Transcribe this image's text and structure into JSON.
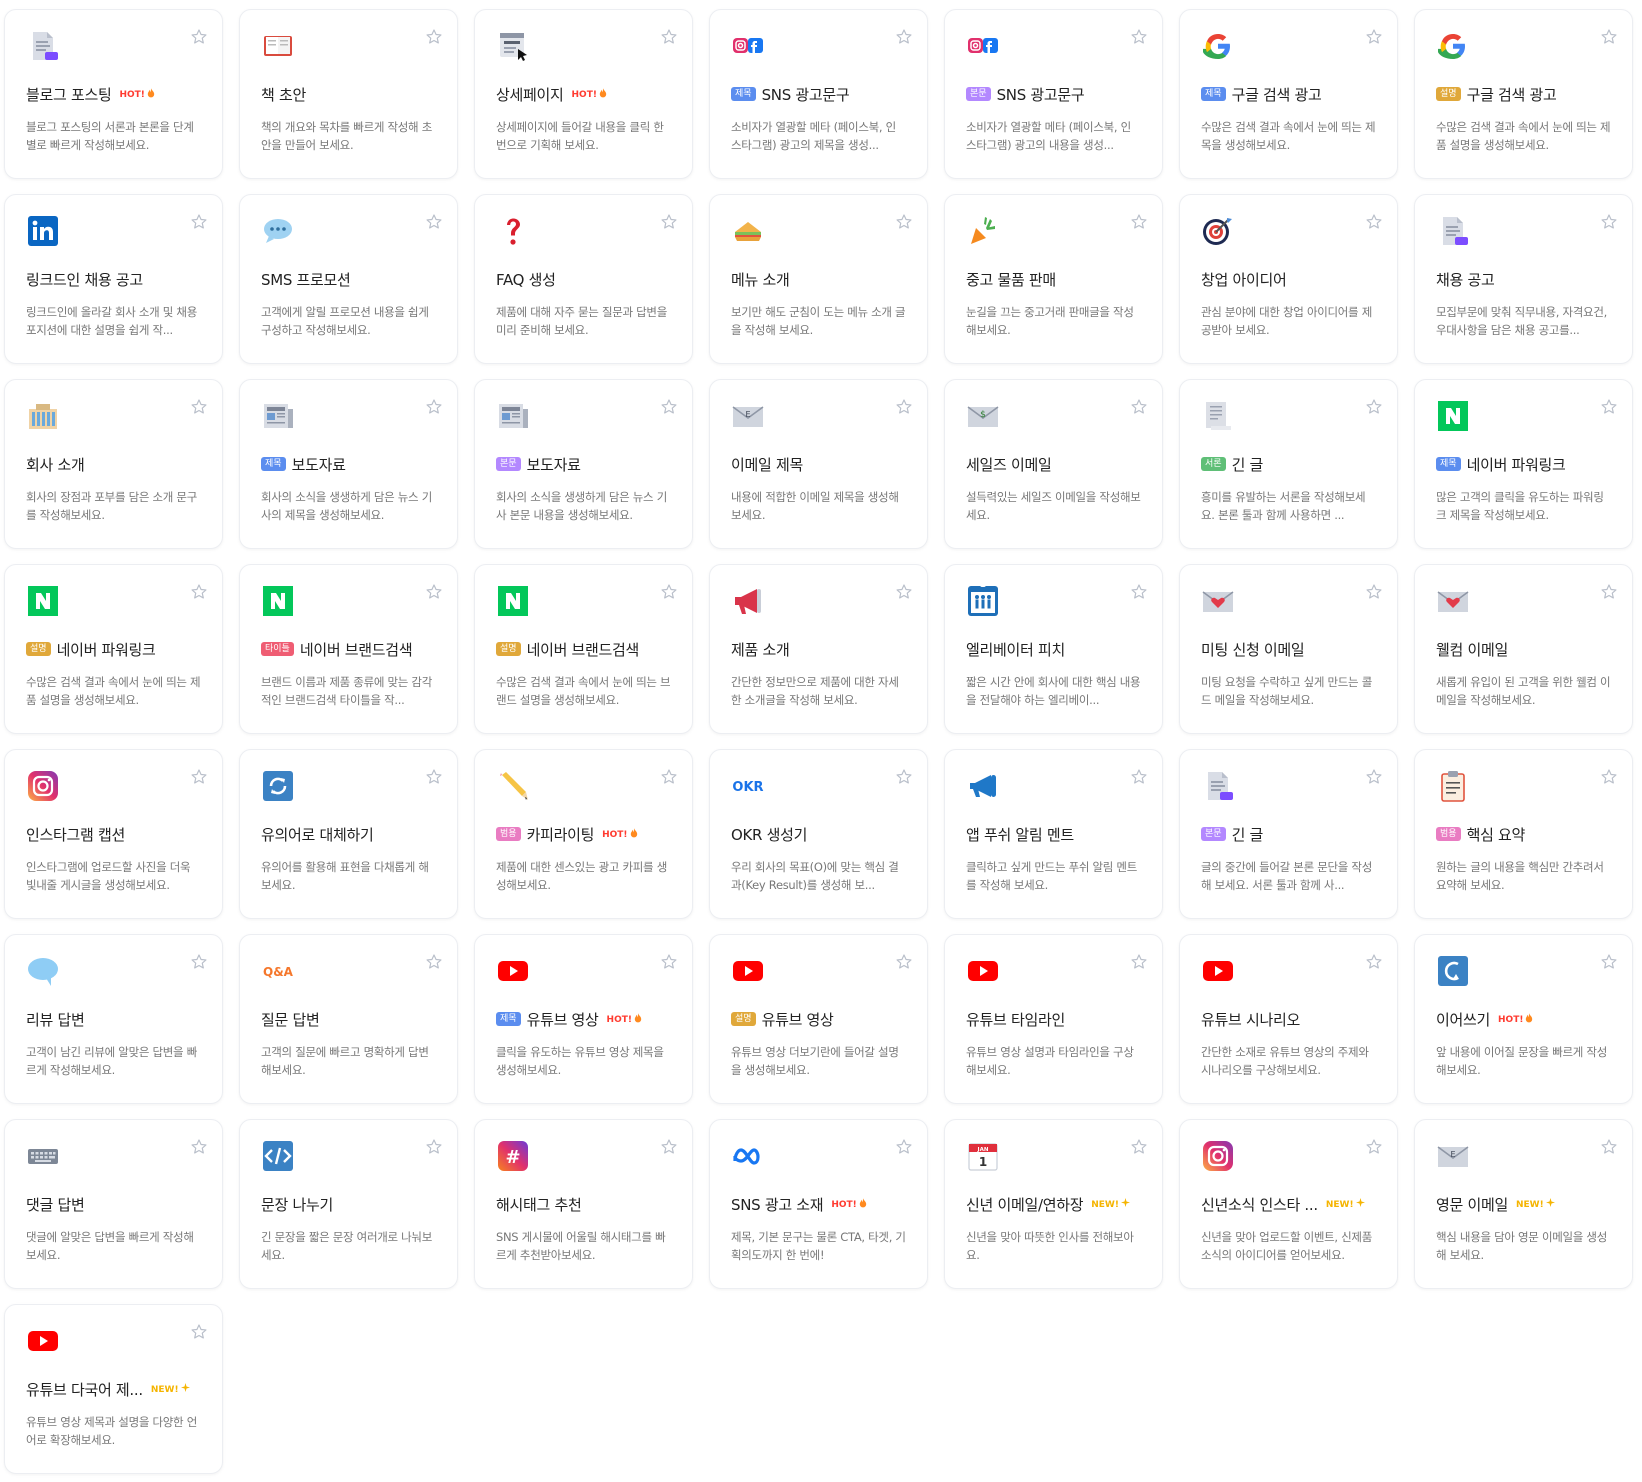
{
  "colors": {
    "tag_title": "#5b8def",
    "tag_body": "#b388ff",
    "tag_desc": "#e0a83a",
    "tag_intro": "#5fbf77",
    "tag_titles": "#ef5d73",
    "tag_general": "#e97cc2",
    "hot": "#ff3b30",
    "new": "#f5b400"
  },
  "cards": [
    {
      "title": "블로그 포스팅",
      "badge": "HOT!",
      "badge_icon": "fire-icon",
      "icon": "document-icon",
      "desc": "블로그 포스팅의 서론과 본론을 단계별로 빠르게 작성해보세요."
    },
    {
      "title": "책 초안",
      "icon": "book-icon",
      "desc": "책의 개요와 목차를 빠르게 작성해 초안을 만들어 보세요."
    },
    {
      "title": "상세페이지",
      "badge": "HOT!",
      "badge_icon": "fire-icon",
      "icon": "webpage-icon",
      "desc": "상세페이지에 들어갈 내용을 클릭 한 번으로 기획해 보세요."
    },
    {
      "tag": "제목",
      "tag_color": "#5b8def",
      "title": "SNS 광고문구",
      "icon": "instagram-facebook-icon",
      "desc": "소비자가 열광할 메타 (페이스북, 인스타그램) 광고의 제목을 생성..."
    },
    {
      "tag": "본문",
      "tag_color": "#b388ff",
      "title": "SNS 광고문구",
      "icon": "instagram-facebook-icon",
      "desc": "소비자가 열광할 메타 (페이스북, 인스타그램) 광고의 내용을 생성..."
    },
    {
      "tag": "제목",
      "tag_color": "#5b8def",
      "title": "구글 검색 광고",
      "icon": "google-icon",
      "desc": "수많은 검색 결과 속에서 눈에 띄는 제목을 생성해보세요."
    },
    {
      "tag": "설명",
      "tag_color": "#e0a83a",
      "title": "구글 검색 광고",
      "icon": "google-icon",
      "desc": "수많은 검색 결과 속에서 눈에 띄는 제품 설명을 생성해보세요."
    },
    {
      "title": "링크드인 채용 공고",
      "icon": "linkedin-icon",
      "desc": "링크드인에 올라갈 회사 소개 및 채용 포지션에 대한 설명을 쉽게 작..."
    },
    {
      "title": "SMS 프로모션",
      "icon": "speech-bubble-icon",
      "desc": "고객에게 알릴 프로모션 내용을 쉽게 구성하고 작성해보세요."
    },
    {
      "title": "FAQ 생성",
      "icon": "question-mark-icon",
      "desc": "제품에 대해 자주 묻는 질문과 답변을 미리 준비해 보세요."
    },
    {
      "title": "메뉴 소개",
      "icon": "sandwich-icon",
      "desc": "보기만 해도 군침이 도는 메뉴 소개 글을 작성해 보세요."
    },
    {
      "title": "중고 물품 판매",
      "icon": "carrot-icon",
      "desc": "눈길을 끄는 중고거래 판매글을 작성해보세요."
    },
    {
      "title": "창업 아이디어",
      "icon": "target-icon",
      "desc": "관심 분야에 대한 창업 아이디어를 제공받아 보세요."
    },
    {
      "title": "채용 공고",
      "icon": "document-icon",
      "desc": "모집부문에 맞춰 직무내용, 자격요건, 우대사항을 담은 채용 공고를..."
    },
    {
      "title": "회사 소개",
      "icon": "office-building-icon",
      "desc": "회사의 장점과 포부를 담은 소개 문구를 작성해보세요."
    },
    {
      "tag": "제목",
      "tag_color": "#5b8def",
      "title": "보도자료",
      "icon": "newspaper-icon",
      "desc": "회사의 소식을 생생하게 담은 뉴스 기사의 제목을 생성해보세요."
    },
    {
      "tag": "본문",
      "tag_color": "#b388ff",
      "title": "보도자료",
      "icon": "newspaper-icon",
      "desc": "회사의 소식을 생생하게 담은 뉴스 기사 본문 내용을 생성해보세요."
    },
    {
      "title": "이메일 제목",
      "icon": "envelope-e-icon",
      "desc": "내용에 적합한 이메일 제목을 생성해보세요."
    },
    {
      "title": "세일즈 이메일",
      "icon": "envelope-dollar-icon",
      "desc": "설득력있는 세일즈 이메일을 작성해보세요."
    },
    {
      "tag": "서론",
      "tag_color": "#5fbf77",
      "title": "긴 글",
      "icon": "page-icon",
      "desc": "흥미를 유발하는 서론을 작성해보세요. 본론 툴과 함께 사용하면 ..."
    },
    {
      "tag": "제목",
      "tag_color": "#5b8def",
      "title": "네이버 파워링크",
      "icon": "naver-icon",
      "desc": "많은 고객의 클릭을 유도하는 파워링크 제목을 작성해보세요."
    },
    {
      "tag": "설명",
      "tag_color": "#e0a83a",
      "title": "네이버 파워링크",
      "icon": "naver-icon",
      "desc": "수많은 검색 결과 속에서 눈에 띄는 제품 설명을 생성해보세요."
    },
    {
      "tag": "타이틀",
      "tag_color": "#ef5d73",
      "title": "네이버 브랜드검색",
      "icon": "naver-icon",
      "desc": "브랜드 이름과 제품 종류에 맞는 감각적인 브랜드검색 타이틀을 작..."
    },
    {
      "tag": "설명",
      "tag_color": "#e0a83a",
      "title": "네이버 브랜드검색",
      "icon": "naver-icon",
      "desc": "수많은 검색 결과 속에서 눈에 띄는 브랜드 설명을 생성해보세요."
    },
    {
      "title": "제품 소개",
      "icon": "megaphone-icon",
      "desc": "간단한 정보만으로 제품에 대한 자세한 소개글을 작성해 보세요."
    },
    {
      "title": "엘리베이터 피치",
      "icon": "elevator-icon",
      "desc": "짧은 시간 안에 회사에 대한 핵심 내용을 전달해야 하는 엘리베이..."
    },
    {
      "title": "미팅 신청 이메일",
      "icon": "envelope-heart-icon",
      "desc": "미팅 요청을 수락하고 싶게 만드는 콜드 메일을 작성해보세요."
    },
    {
      "title": "웰컴 이메일",
      "icon": "envelope-heart-icon",
      "desc": "새롭게 유입이 된 고객을 위한 웰컴 이메일을 작성해보세요."
    },
    {
      "title": "인스타그램 캡션",
      "icon": "instagram-icon",
      "desc": "인스타그램에 업로드할 사진을 더욱 빛내줄 게시글을 생성해보세요."
    },
    {
      "title": "유의어로 대체하기",
      "icon": "refresh-icon",
      "desc": "유의어를 활용해 표현을 다채롭게 해보세요."
    },
    {
      "tag": "범용",
      "tag_color": "#e97cc2",
      "title": "카피라이팅",
      "badge": "HOT!",
      "badge_icon": "fire-icon",
      "icon": "pencil-icon",
      "desc": "제품에 대한 센스있는 광고 카피를 생성해보세요."
    },
    {
      "title": "OKR 생성기",
      "icon": "okr-icon",
      "desc": "우리 회사의 목표(O)에 맞는 핵심 결과(Key Result)를 생성해 보..."
    },
    {
      "title": "앱 푸쉬 알림 멘트",
      "icon": "megaphone-blue-icon",
      "desc": "클릭하고 싶게 만드는 푸쉬 알림 멘트를 작성해 보세요."
    },
    {
      "tag": "본문",
      "tag_color": "#b388ff",
      "title": "긴 글",
      "icon": "document-icon",
      "desc": "글의 중간에 들어갈 본론 문단을 작성해 보세요. 서론 툴과 함께 사..."
    },
    {
      "tag": "범용",
      "tag_color": "#e97cc2",
      "title": "핵심 요약",
      "icon": "clipboard-icon",
      "desc": "원하는 글의 내용을 핵심만 간추려서 요약해 보세요."
    },
    {
      "title": "리뷰 답변",
      "icon": "chat-bubble-icon",
      "desc": "고객이 남긴 리뷰에 알맞은 답변을 빠르게 작성해보세요."
    },
    {
      "title": "질문 답변",
      "icon": "qa-icon",
      "desc": "고객의 질문에 빠르고 명확하게 답변해보세요."
    },
    {
      "tag": "제목",
      "tag_color": "#5b8def",
      "title": "유튜브 영상",
      "badge": "HOT!",
      "badge_icon": "fire-icon",
      "icon": "youtube-icon",
      "desc": "클릭을 유도하는 유튜브 영상 제목을 생성해보세요."
    },
    {
      "tag": "설명",
      "tag_color": "#e0a83a",
      "title": "유튜브 영상",
      "icon": "youtube-icon",
      "desc": "유튜브 영상 더보기란에 들어갈 설명을 생성해보세요."
    },
    {
      "title": "유튜브 타임라인",
      "icon": "youtube-icon",
      "desc": "유튜브 영상 설명과 타임라인을 구상해보세요."
    },
    {
      "title": "유튜브 시나리오",
      "icon": "youtube-icon",
      "desc": "간단한 소재로 유튜브 영상의 주제와 시나리오를 구상해보세요."
    },
    {
      "title": "이어쓰기",
      "badge": "HOT!",
      "badge_icon": "fire-icon",
      "icon": "continue-arrow-icon",
      "desc": "앞 내용에 이어질 문장을 빠르게 작성해보세요."
    },
    {
      "title": "댓글 답변",
      "icon": "keyboard-icon",
      "desc": "댓글에 알맞은 답변을 빠르게 작성해보세요."
    },
    {
      "title": "문장 나누기",
      "icon": "code-split-icon",
      "desc": "긴 문장을 짧은 문장 여러개로 나눠보세요."
    },
    {
      "title": "해시태그 추천",
      "icon": "hashtag-icon",
      "desc": "SNS 게시물에 어울릴 해시태그를 빠르게 추천받아보세요."
    },
    {
      "title": "SNS 광고 소재",
      "badge": "HOT!",
      "badge_icon": "fire-icon",
      "icon": "meta-icon",
      "desc": "제목, 기본 문구는 물론 CTA, 타겟, 기획의도까지 한 번에!"
    },
    {
      "title": "신년 이메일/연하장",
      "badge": "NEW!",
      "badge_icon": "sparkle-icon",
      "icon": "calendar-icon",
      "desc": "신년을 맞아 따뜻한 인사를 전해보아요."
    },
    {
      "title": "신년소식 인스타 ...",
      "badge": "NEW!",
      "badge_icon": "sparkle-icon",
      "icon": "instagram-icon",
      "desc": "신년을 맞아 업로드할 이벤트, 신제품 소식의 아이디어를 얻어보세요."
    },
    {
      "title": "영문 이메일",
      "badge": "NEW!",
      "badge_icon": "sparkle-icon",
      "icon": "envelope-e-icon",
      "desc": "핵심 내용을 담아 영문 이메일을 생성해 보세요."
    },
    {
      "title": "유튜브 다국어 제...",
      "badge": "NEW!",
      "badge_icon": "sparkle-icon",
      "icon": "youtube-icon",
      "desc": "유튜브 영상 제목과 설명을 다양한 언어로 확장해보세요."
    }
  ]
}
